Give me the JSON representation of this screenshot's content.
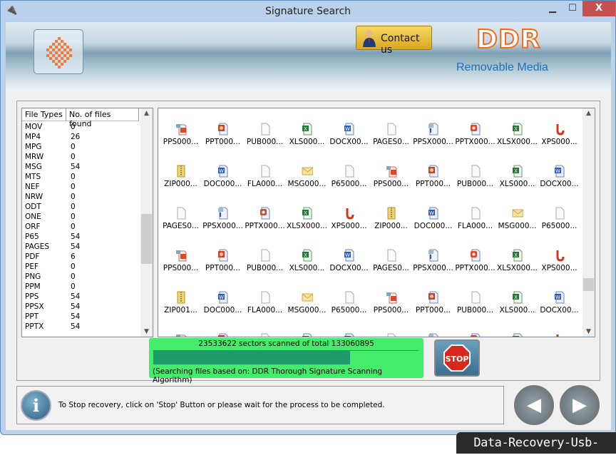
{
  "window": {
    "title": "Signature Search",
    "minimize": "▁",
    "maximize": "☐",
    "close": "X"
  },
  "header": {
    "contact_label": "Contact us",
    "brand": "DDR",
    "product": "Removable Media"
  },
  "file_types": {
    "columns": [
      "File Types",
      "No. of files found"
    ],
    "rows": [
      [
        "MOV",
        "0"
      ],
      [
        "MP4",
        "26"
      ],
      [
        "MPG",
        "0"
      ],
      [
        "MRW",
        "0"
      ],
      [
        "MSG",
        "54"
      ],
      [
        "MTS",
        "0"
      ],
      [
        "NEF",
        "0"
      ],
      [
        "NRW",
        "0"
      ],
      [
        "ODT",
        "0"
      ],
      [
        "ONE",
        "0"
      ],
      [
        "ORF",
        "0"
      ],
      [
        "P65",
        "54"
      ],
      [
        "PAGES",
        "54"
      ],
      [
        "PDF",
        "6"
      ],
      [
        "PEF",
        "0"
      ],
      [
        "PNG",
        "0"
      ],
      [
        "PPM",
        "0"
      ],
      [
        "PPS",
        "54"
      ],
      [
        "PPSX",
        "54"
      ],
      [
        "PPT",
        "54"
      ],
      [
        "PPTX",
        "54"
      ]
    ]
  },
  "files": {
    "rows": [
      [
        [
          "pps",
          "PPS000..."
        ],
        [
          "ppt",
          "PPT000..."
        ],
        [
          "blank",
          "PUB000..."
        ],
        [
          "xls",
          "XLS000..."
        ],
        [
          "doc",
          "DOCX00..."
        ],
        [
          "blank",
          "PAGES0..."
        ],
        [
          "ppsx",
          "PPSX000..."
        ],
        [
          "pptx",
          "PPTX000..."
        ],
        [
          "xls",
          "XLSX000..."
        ],
        [
          "xps",
          "XPS000..."
        ]
      ],
      [
        [
          "zip",
          "ZIP000..."
        ],
        [
          "doc",
          "DOC000..."
        ],
        [
          "blank",
          "FLA000..."
        ],
        [
          "msg",
          "MSG000..."
        ],
        [
          "blank",
          "P65000..."
        ],
        [
          "pps",
          "PPS000..."
        ],
        [
          "ppt",
          "PPT000..."
        ],
        [
          "blank",
          "PUB000..."
        ],
        [
          "xls",
          "XLS000..."
        ],
        [
          "doc",
          "DOCX00..."
        ]
      ],
      [
        [
          "blank",
          "PAGES0..."
        ],
        [
          "ppsx",
          "PPSX000..."
        ],
        [
          "pptx",
          "PPTX000..."
        ],
        [
          "xls",
          "XLSX000..."
        ],
        [
          "xps",
          "XPS000..."
        ],
        [
          "zip",
          "ZIP000..."
        ],
        [
          "doc",
          "DOC000..."
        ],
        [
          "blank",
          "FLA000..."
        ],
        [
          "msg",
          "MSG000..."
        ],
        [
          "blank",
          "P65000..."
        ]
      ],
      [
        [
          "pps",
          "PPS000..."
        ],
        [
          "ppt",
          "PPT000..."
        ],
        [
          "blank",
          "PUB000..."
        ],
        [
          "xls",
          "XLS000..."
        ],
        [
          "doc",
          "DOCX00..."
        ],
        [
          "blank",
          "PAGES0..."
        ],
        [
          "ppsx",
          "PPSX000..."
        ],
        [
          "pptx",
          "PPTX000..."
        ],
        [
          "xls",
          "XLSX000..."
        ],
        [
          "xps",
          "XPS000..."
        ]
      ],
      [
        [
          "zip",
          "ZIP001..."
        ],
        [
          "doc",
          "DOC000..."
        ],
        [
          "blank",
          "FLA000..."
        ],
        [
          "msg",
          "MSG000..."
        ],
        [
          "blank",
          "P65000..."
        ],
        [
          "pps",
          "PPS000..."
        ],
        [
          "ppt",
          "PPT000..."
        ],
        [
          "blank",
          "PUB000..."
        ],
        [
          "xls",
          "XLS000..."
        ],
        [
          "doc",
          "DOCX00..."
        ]
      ]
    ]
  },
  "progress": {
    "sectors_text": "23533622 sectors scanned of total 133060895",
    "scanned": 23533622,
    "total": 133060895,
    "bar_fraction": 0.74,
    "algorithm_text": "(Searching files based on:  DDR Thorough Signature Scanning Algorithm)",
    "stop_label": "STOP"
  },
  "status": {
    "message": "To Stop recovery, click on 'Stop' Button or please wait for the process to be completed."
  },
  "nav": {
    "back": "◀",
    "next": "▶"
  },
  "watermark": "Data-Recovery-Usb-Drive.com",
  "colors": {
    "progress_bg": "#44ec6c",
    "progress_fill": "#1f9a6b",
    "brand_orange": "#f36a1a",
    "brand_blue": "#1f6fb5",
    "close_red": "#c75050"
  }
}
